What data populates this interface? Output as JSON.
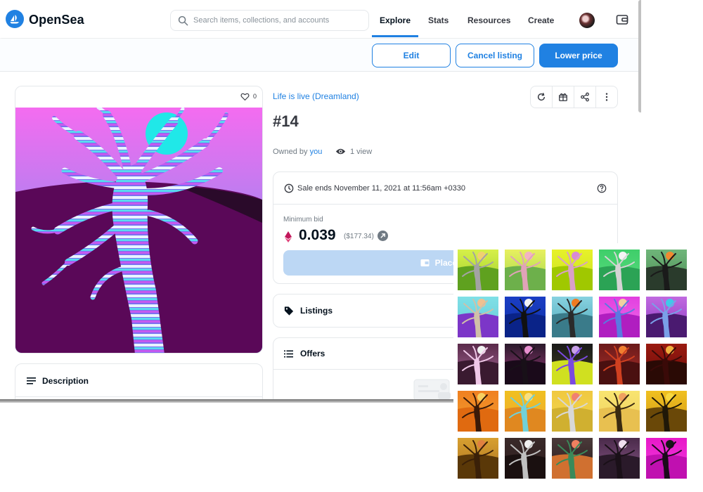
{
  "app": {
    "name": "OpenSea"
  },
  "search": {
    "placeholder": "Search items, collections, and accounts"
  },
  "nav": {
    "explore": "Explore",
    "stats": "Stats",
    "resources": "Resources",
    "create": "Create"
  },
  "actions": {
    "edit": "Edit",
    "cancel_listing": "Cancel listing",
    "lower_price": "Lower price"
  },
  "item": {
    "favorites": "0",
    "collection": "Life is live (Dreamland)",
    "title": "#14",
    "owned_by_prefix": "Owned by",
    "owner": "you",
    "views": "1 view"
  },
  "sale": {
    "ends_text": "Sale ends November 11, 2021 at 11:56am +0330",
    "min_bid_label": "Minimum bid",
    "price": "0.039",
    "price_usd": "($177.34)",
    "place_bid": "Place bid"
  },
  "sections": {
    "listings": "Listings",
    "offers": "Offers",
    "description": "Description"
  },
  "colors": {
    "accent": "#2081e2",
    "bid_disabled": "#bcd7f4"
  },
  "icons": [
    "search-icon",
    "wallet-icon",
    "heart-icon",
    "refresh-icon",
    "gift-icon",
    "share-icon",
    "more-icon",
    "eye-icon",
    "clock-icon",
    "help-icon",
    "eth-icon",
    "tag-icon",
    "list-icon"
  ],
  "thumbnails": [
    {
      "bg1": "#d7f04a",
      "bg2": "#9ccc2b",
      "ground": "#5fa11f",
      "tree": "#a3a3a3",
      "sun": "#f0d070"
    },
    {
      "bg1": "#e8f060",
      "bg2": "#9fd64a",
      "ground": "#6db04b",
      "tree": "#e0a3b8",
      "sun": "#f3b3c3"
    },
    {
      "bg1": "#e8f22a",
      "bg2": "#c4e020",
      "ground": "#a0c800",
      "tree": "#d9a0c8",
      "sun": "#d88ad6"
    },
    {
      "bg1": "#3fce6a",
      "bg2": "#5adc7f",
      "ground": "#2ba355",
      "tree": "#d4d4d4",
      "sun": "#f4f4f4"
    },
    {
      "bg1": "#6fb67a",
      "bg2": "#4d8a54",
      "ground": "#2a3b2c",
      "tree": "#1a1a1a",
      "sun": "#f08a30"
    },
    {
      "bg1": "#7fe0e6",
      "bg2": "#66c8d8",
      "ground": "#7c36c8",
      "tree": "#d0c0a8",
      "sun": "#f0c090"
    },
    {
      "bg1": "#1b3ec4",
      "bg2": "#0d2fa6",
      "ground": "#0a2388",
      "tree": "#111111",
      "sun": "#f4f4f4"
    },
    {
      "bg1": "#88d2e0",
      "bg2": "#4aa6b8",
      "ground": "#3a7b8a",
      "tree": "#2a2a2a",
      "sun": "#f07a20"
    },
    {
      "bg1": "#e23fe0",
      "bg2": "#f070e8",
      "ground": "#b01ec0",
      "tree": "#5a7ae0",
      "sun": "#f0d0a0"
    },
    {
      "bg1": "#c06ae0",
      "bg2": "#8a3ac0",
      "ground": "#4a1a70",
      "tree": "#7aa0e8",
      "sun": "#40c8e8"
    },
    {
      "bg1": "#5a2a4a",
      "bg2": "#a86a9a",
      "ground": "#3a1a30",
      "tree": "#f0c8e8",
      "sun": "#f0f0f0"
    },
    {
      "bg1": "#2a1a2a",
      "bg2": "#a03a80",
      "ground": "#1a0a1a",
      "tree": "#181018",
      "sun": "#e890d0"
    },
    {
      "bg1": "#1a1a1a",
      "bg2": "#404020",
      "ground": "#d0e020",
      "tree": "#7a4ae0",
      "sun": "#c8a0e8"
    },
    {
      "bg1": "#6a1a1a",
      "bg2": "#b0302a",
      "ground": "#4a1010",
      "tree": "#d04020",
      "sun": "#f08030"
    },
    {
      "bg1": "#9a1a10",
      "bg2": "#6a0a08",
      "ground": "#2a0a05",
      "tree": "#3a0a08",
      "sun": "#f0b040"
    },
    {
      "bg1": "#f08020",
      "bg2": "#f0a030",
      "ground": "#e06a10",
      "tree": "#3a1a08",
      "sun": "#f8d060"
    },
    {
      "bg1": "#f0c020",
      "bg2": "#f0a830",
      "ground": "#e08820",
      "tree": "#70d0d8",
      "sun": "#f8e080"
    },
    {
      "bg1": "#f0c840",
      "bg2": "#f0d850",
      "ground": "#d0b030",
      "tree": "#d8d8d8",
      "sun": "#f08070"
    },
    {
      "bg1": "#f8e470",
      "bg2": "#f0d060",
      "ground": "#e8c050",
      "tree": "#3a2a10",
      "sun": "#f0a060"
    },
    {
      "bg1": "#f0c020",
      "bg2": "#d09818",
      "ground": "#6a4808",
      "tree": "#201808",
      "sun": "#f8d840"
    },
    {
      "bg1": "#d8a030",
      "bg2": "#a87020",
      "ground": "#5a3808",
      "tree": "#3a2008",
      "sun": "#e08040"
    },
    {
      "bg1": "#3a2a2a",
      "bg2": "#2a1a1a",
      "ground": "#1a1010",
      "tree": "#c0c0c0",
      "sun": "#f0f0f0"
    },
    {
      "bg1": "#4a3a3a",
      "bg2": "#2a1a1a",
      "ground": "#d07030",
      "tree": "#3a8a5a",
      "sun": "#f08060"
    },
    {
      "bg1": "#4a2a4a",
      "bg2": "#8a5a8a",
      "ground": "#2a1a2a",
      "tree": "#1a1018",
      "sun": "#f0e0f0"
    },
    {
      "bg1": "#e818c8",
      "bg2": "#f040e0",
      "ground": "#c010b0",
      "tree": "#1a0a1a",
      "sun": "#181818"
    }
  ]
}
